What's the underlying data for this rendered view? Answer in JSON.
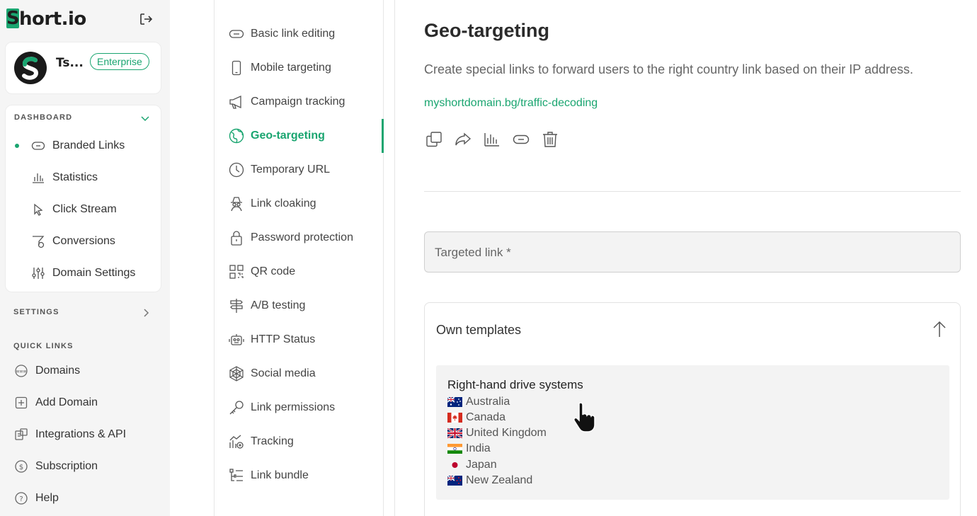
{
  "brand": {
    "logo_text": "hort.io",
    "logo_mark": "S",
    "accent": "#1aa570"
  },
  "account": {
    "name": "Ts...",
    "plan": "Enterprise"
  },
  "dashboard": {
    "title": "DASHBOARD",
    "items": [
      {
        "label": "Branded Links",
        "icon": "link-icon"
      },
      {
        "label": "Statistics",
        "icon": "bar-chart-icon"
      },
      {
        "label": "Click Stream",
        "icon": "cursor-icon"
      },
      {
        "label": "Conversions",
        "icon": "funnel-icon"
      },
      {
        "label": "Domain Settings",
        "icon": "sliders-icon"
      }
    ]
  },
  "settings": {
    "title": "SETTINGS"
  },
  "quick_links": {
    "title": "QUICK LINKS",
    "items": [
      {
        "label": "Domains",
        "icon": "www-icon"
      },
      {
        "label": "Add Domain",
        "icon": "plus-square-icon"
      },
      {
        "label": "Integrations & API",
        "icon": "api-icon"
      },
      {
        "label": "Subscription",
        "icon": "dollar-icon"
      },
      {
        "label": "Help",
        "icon": "help-icon"
      }
    ]
  },
  "menu": {
    "items": [
      {
        "label": "Basic link editing",
        "icon": "link-icon"
      },
      {
        "label": "Mobile targeting",
        "icon": "mobile-icon"
      },
      {
        "label": "Campaign tracking",
        "icon": "megaphone-icon"
      },
      {
        "label": "Geo-targeting",
        "icon": "globe-icon",
        "active": true
      },
      {
        "label": "Temporary URL",
        "icon": "clock-icon"
      },
      {
        "label": "Link cloaking",
        "icon": "spy-icon"
      },
      {
        "label": "Password protection",
        "icon": "lock-icon"
      },
      {
        "label": "QR code",
        "icon": "qr-icon"
      },
      {
        "label": "A/B testing",
        "icon": "signpost-icon"
      },
      {
        "label": "HTTP Status",
        "icon": "robot-icon"
      },
      {
        "label": "Social media",
        "icon": "web-icon"
      },
      {
        "label": "Link permissions",
        "icon": "key-icon"
      },
      {
        "label": "Tracking",
        "icon": "tracking-icon"
      },
      {
        "label": "Link bundle",
        "icon": "list-tree-icon"
      }
    ]
  },
  "main": {
    "title": "Geo-targeting",
    "description": "Create special links to forward users to the right country link based on their IP address.",
    "short_link": "myshortdomain.bg/traffic-decoding",
    "actions": [
      "copy-icon",
      "share-icon",
      "stats-icon",
      "link-icon",
      "trash-icon"
    ],
    "targeted_link_placeholder": "Targeted link *",
    "templates": {
      "title": "Own templates",
      "items": [
        {
          "name": "Right-hand drive systems",
          "countries": [
            "Australia",
            "Canada",
            "United Kingdom",
            "India",
            "Japan",
            "New Zealand"
          ]
        }
      ]
    }
  }
}
